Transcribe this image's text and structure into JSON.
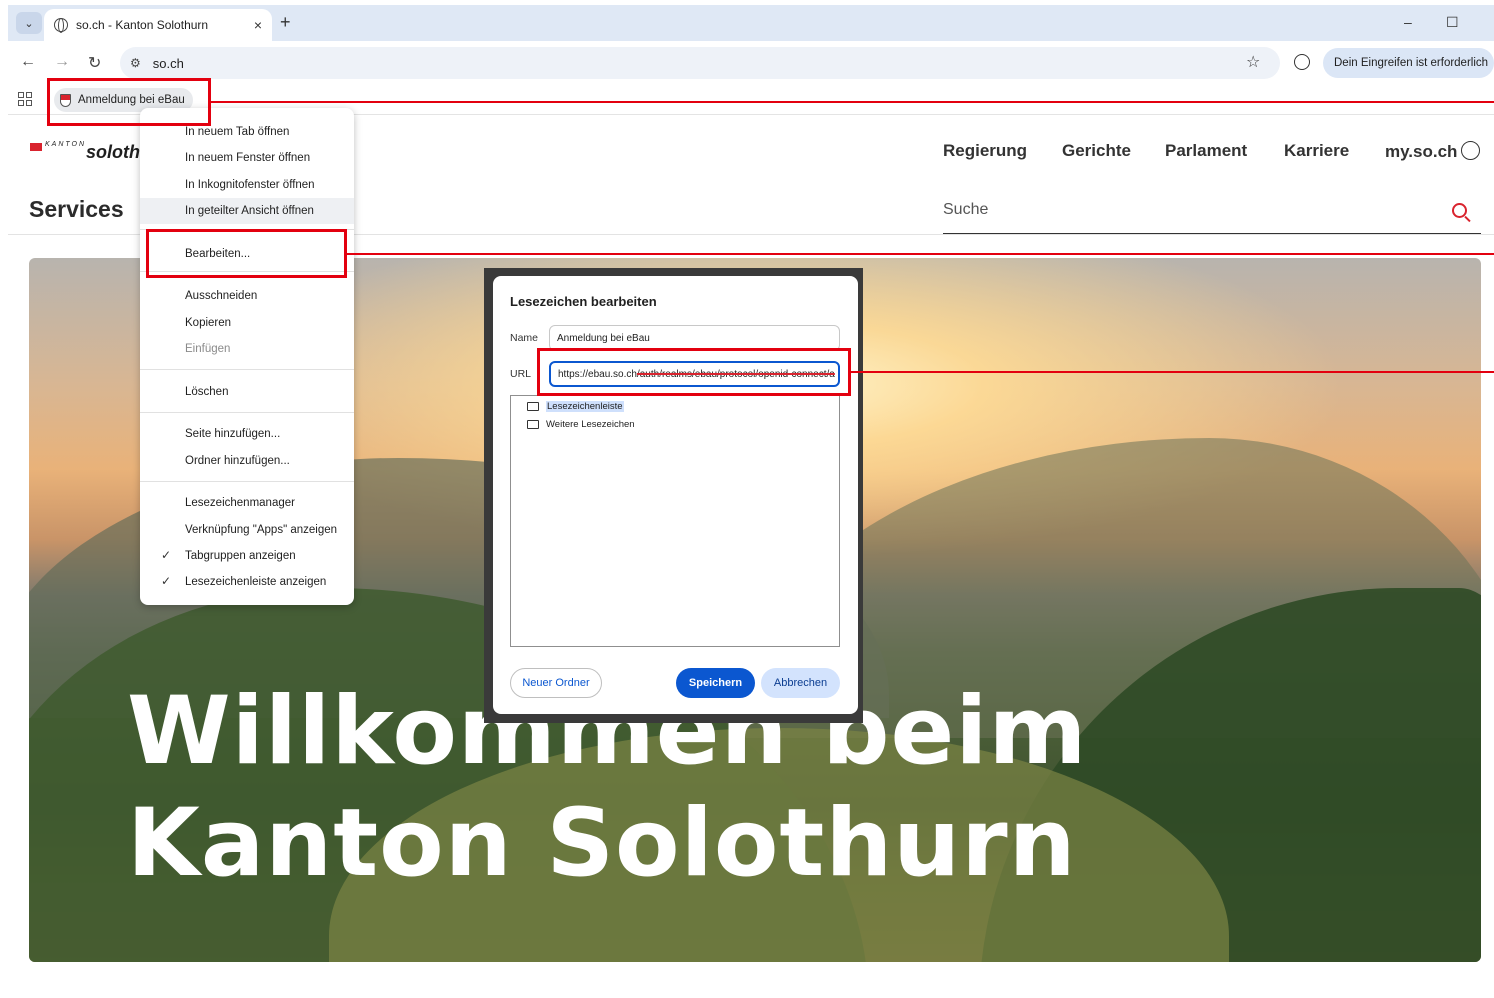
{
  "browser": {
    "tab_title": "so.ch - Kanton Solothurn",
    "tab_close": "×",
    "new_tab": "+",
    "tab_list": "⌄",
    "minimize": "–",
    "maximize": "☐",
    "address": "so.ch",
    "back": "←",
    "forward": "→",
    "reload": "↻",
    "star": "☆",
    "action_pill": "Dein Eingreifen ist erforderlich",
    "bookmark_label": "Anmeldung bei eBau"
  },
  "site": {
    "logo_kanton": "KANTON",
    "logo_name": "soloth",
    "nav": [
      "Regierung",
      "Gerichte",
      "Parlament",
      "Karriere",
      "my.so.ch"
    ],
    "services": "Services",
    "search_placeholder": "Suche",
    "hero_line1": "Willkommen beim",
    "hero_line2": "Kanton Solothurn"
  },
  "context_menu": {
    "items": [
      "In neuem Tab öffnen",
      "In neuem Fenster öffnen",
      "In Inkognitofenster öffnen",
      "In geteilter Ansicht öffnen",
      "Bearbeiten...",
      "Ausschneiden",
      "Kopieren",
      "Einfügen",
      "Löschen",
      "Seite hinzufügen...",
      "Ordner hinzufügen...",
      "Lesezeichenmanager",
      "Verknüpfung \"Apps\" anzeigen",
      "Tabgruppen anzeigen",
      "Lesezeichenleiste anzeigen"
    ],
    "checkmark": "✓"
  },
  "dialog": {
    "title": "Lesezeichen bearbeiten",
    "name_label": "Name",
    "name_value": "Anmeldung bei eBau",
    "url_label": "URL",
    "url_visible": "https://ebau.so.ch",
    "url_struck": "/auth/realms/ebau/protocol/openid-connect/a",
    "folders": [
      "Lesezeichenleiste",
      "Weitere Lesezeichen"
    ],
    "new_folder": "Neuer Ordner",
    "save": "Speichern",
    "cancel": "Abbrechen"
  },
  "colors": {
    "annotation_red": "#e3000f",
    "primary_blue": "#0b57d0",
    "brand_red": "#d9232e"
  }
}
